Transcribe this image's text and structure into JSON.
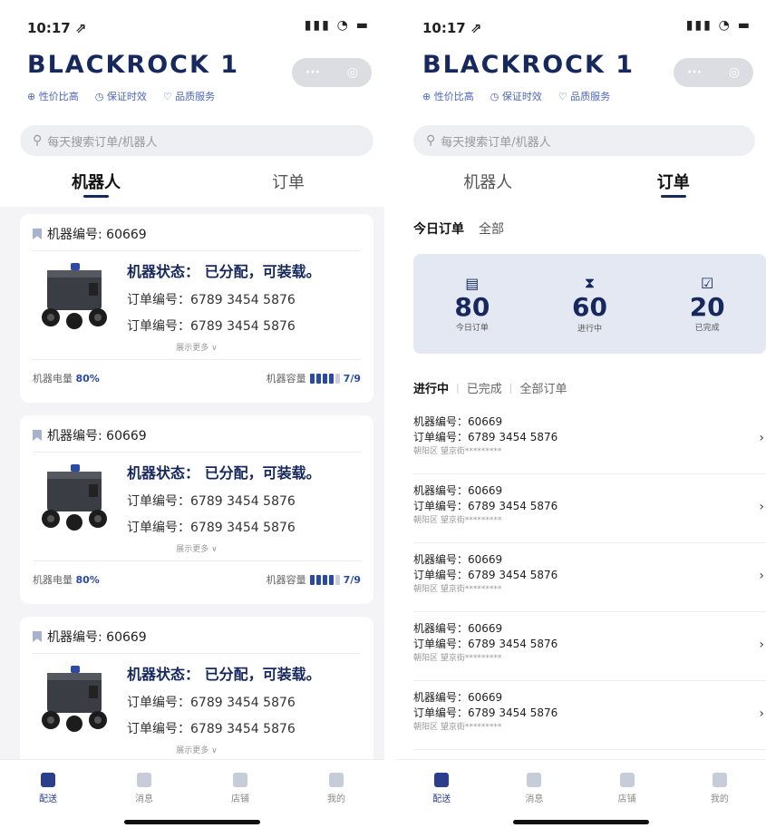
{
  "left": {
    "status_time": "10:17 ⇗",
    "status_icons": "▮▮▮ ◔ ▬",
    "brand": "BLACKROCK 1",
    "tags": [
      "⊕ 性价比高",
      "◷ 保证时效",
      "♡ 品质服务"
    ],
    "capsule": {
      "more": "···",
      "close": "◎"
    },
    "search_placeholder": "每天搜索订单/机器人",
    "tabs": [
      "机器人",
      "订单"
    ],
    "cards": [
      {
        "machine_label": "机器编号: 60669",
        "status": "机器状态：  已分配，可装载。",
        "order1": "订单编号：6789 3454 5876",
        "order2": "订单编号：6789 3454 5876",
        "more": "展示更多 ∨",
        "battery_label": "机器电量",
        "battery_value": "80%",
        "capacity_label": "机器容量",
        "capacity_value": "7/9",
        "capacity_level": 0.8
      },
      {
        "machine_label": "机器编号: 60669",
        "status": "机器状态：  已分配，可装载。",
        "order1": "订单编号：6789 3454 5876",
        "order2": "订单编号：6789 3454 5876",
        "more": "展示更多 ∨",
        "battery_label": "机器电量",
        "battery_value": "80%",
        "capacity_label": "机器容量",
        "capacity_value": "7/9",
        "capacity_level": 0.8
      },
      {
        "machine_label": "机器编号: 60669",
        "status": "机器状态：  已分配，可装载。",
        "order1": "订单编号：6789 3454 5876",
        "order2": "订单编号：6789 3454 5876",
        "more": "展示更多 ∨"
      }
    ],
    "tabbar": [
      "配送",
      "消息",
      "店铺",
      "我的"
    ]
  },
  "right": {
    "status_time": "10:17 ⇗",
    "status_icons": "▮▮▮ ◔ ▬",
    "brand": "BLACKROCK 1",
    "tags": [
      "⊕ 性价比高",
      "◷ 保证时效",
      "♡ 品质服务"
    ],
    "capsule": {
      "more": "···",
      "close": "◎"
    },
    "search_placeholder": "每天搜索订单/机器人",
    "tabs": [
      "机器人",
      "订单"
    ],
    "subtabs": [
      "今日订单",
      "全部"
    ],
    "stats": [
      {
        "icon": "▤",
        "num": "80",
        "label": "今日订单"
      },
      {
        "icon": "⧗",
        "num": "60",
        "label": "进行中"
      },
      {
        "icon": "☑",
        "num": "20",
        "label": "已完成"
      }
    ],
    "filters": [
      "进行中",
      "已完成",
      "全部订单"
    ],
    "orders": [
      {
        "machine": "机器编号：60669",
        "order": "订单编号：6789 3454 5876",
        "address": "朝阳区 望京街*********"
      },
      {
        "machine": "机器编号：60669",
        "order": "订单编号：6789 3454 5876",
        "address": "朝阳区 望京街*********"
      },
      {
        "machine": "机器编号：60669",
        "order": "订单编号：6789 3454 5876",
        "address": "朝阳区 望京街*********"
      },
      {
        "machine": "机器编号：60669",
        "order": "订单编号：6789 3454 5876",
        "address": "朝阳区 望京街*********"
      },
      {
        "machine": "机器编号：60669",
        "order": "订单编号：6789 3454 5876",
        "address": "朝阳区 望京街*********"
      }
    ],
    "tabbar": [
      "配送",
      "消息",
      "店铺",
      "我的"
    ]
  }
}
